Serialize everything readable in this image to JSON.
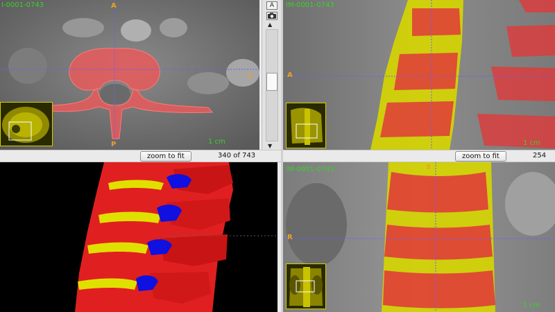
{
  "views": {
    "axial": {
      "series_label": "I-0001-0743",
      "orient_top": "A",
      "orient_right": "L",
      "orient_bottom": "P",
      "scale_label": "1 cm"
    },
    "sagittal": {
      "series_label": "IM-0001-0743",
      "orient_left": "A",
      "scale_label": "1 cm"
    },
    "surface3d": {},
    "coronal": {
      "series_label": "IM-0001-0743",
      "orient_top": "S",
      "orient_left": "R",
      "scale_label": "1 cm"
    }
  },
  "toolbar": {
    "zoom_left_label": "zoom to fit",
    "slice_left": "340 of 743",
    "zoom_right_label": "zoom to fit",
    "slice_right": "254"
  },
  "scroll": {
    "a_button": "A",
    "camera_icon": "camera-icon",
    "up_arrow": "▲",
    "down_arrow": "▼"
  },
  "colors": {
    "segmentation_red": "#e03a3a",
    "disc_yellow": "#d6d600",
    "label_green": "#39d12b",
    "orient_orange": "#f0a020",
    "crosshair": "#6060ff",
    "process_blue": "#1010e0"
  }
}
